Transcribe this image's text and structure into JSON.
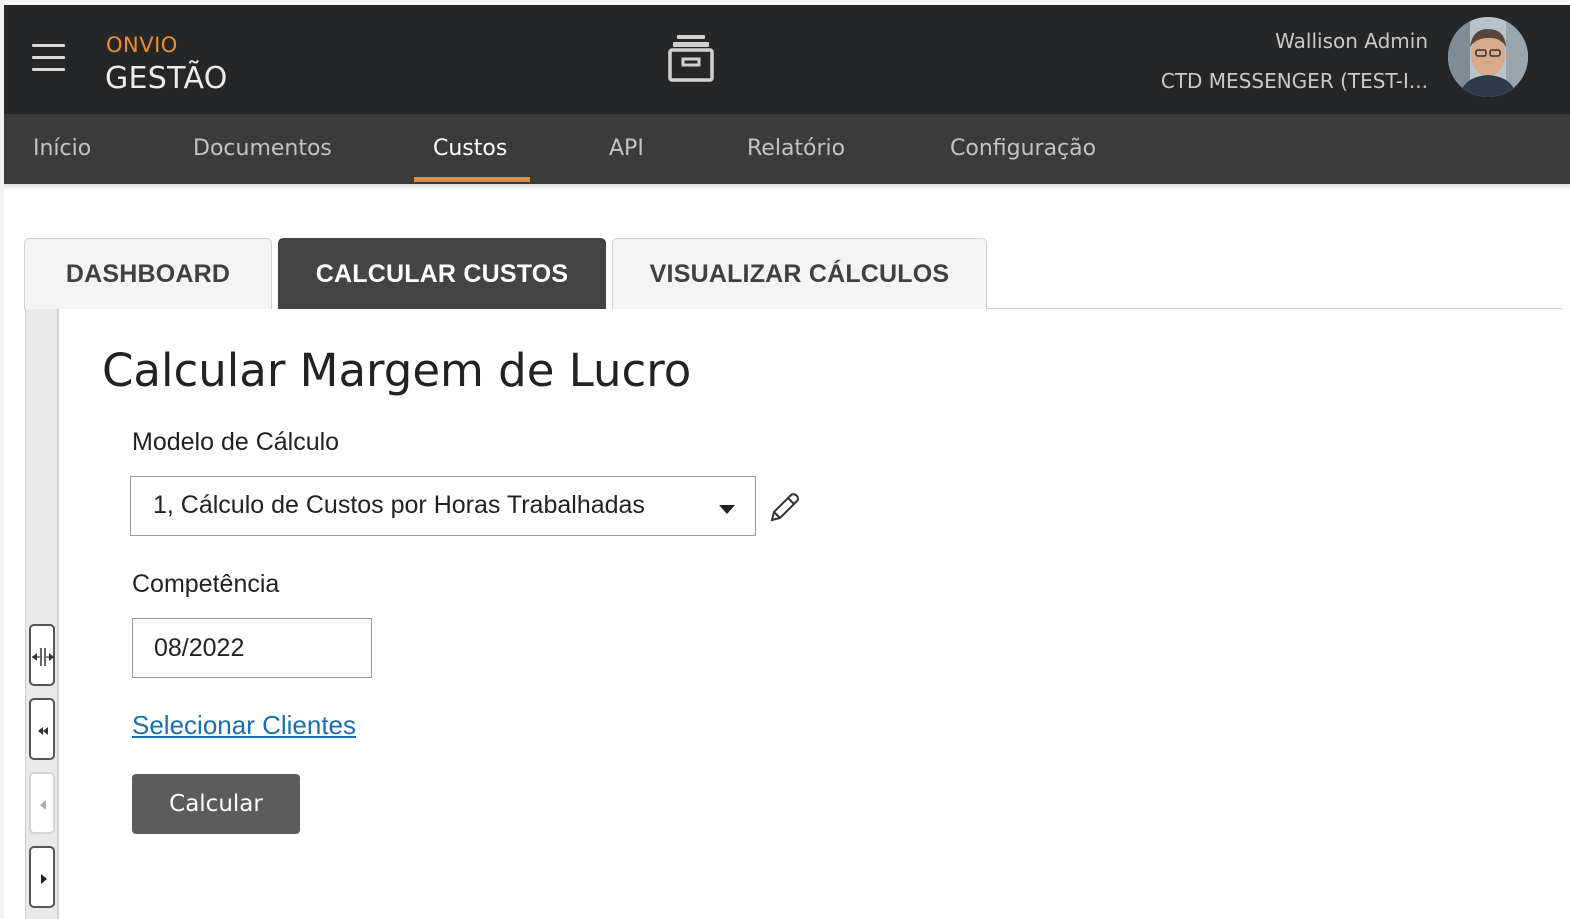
{
  "header": {
    "brand_small": "ONVIO",
    "brand_big": "GESTÃO",
    "user_name": "Wallison Admin",
    "user_org": "CTD MESSENGER (TEST-I...",
    "icons": [
      "hamburger-menu-icon",
      "archive-box-icon",
      "user-avatar"
    ]
  },
  "nav": {
    "items": [
      {
        "label": "Início"
      },
      {
        "label": "Documentos"
      },
      {
        "label": "Custos",
        "active": true
      },
      {
        "label": "API"
      },
      {
        "label": "Relatório"
      },
      {
        "label": "Configuração"
      }
    ]
  },
  "tabs": [
    {
      "label": "DASHBOARD"
    },
    {
      "label": "CALCULAR CUSTOS",
      "active": true
    },
    {
      "label": "VISUALIZAR CÁLCULOS"
    }
  ],
  "form": {
    "title": "Calcular Margem de Lucro",
    "model_label": "Modelo de Cálculo",
    "model_value": "1, Cálculo de Custos por Horas Trabalhadas",
    "competencia_label": "Competência",
    "competencia_value": "08/2022",
    "select_clients_link": "Selecionar Clientes",
    "calculate_button": "Calcular"
  },
  "side_rail": {
    "icons": [
      "resize-handle-icon",
      "collapse-double-left-icon",
      "arrow-left-icon",
      "arrow-right-icon"
    ]
  },
  "colors": {
    "topbar": "#252627",
    "navbar": "#3b3b3c",
    "accent": "#f28b2b",
    "active_tab": "#444444",
    "link": "#1a6fb0",
    "button": "#5c5c5c"
  }
}
